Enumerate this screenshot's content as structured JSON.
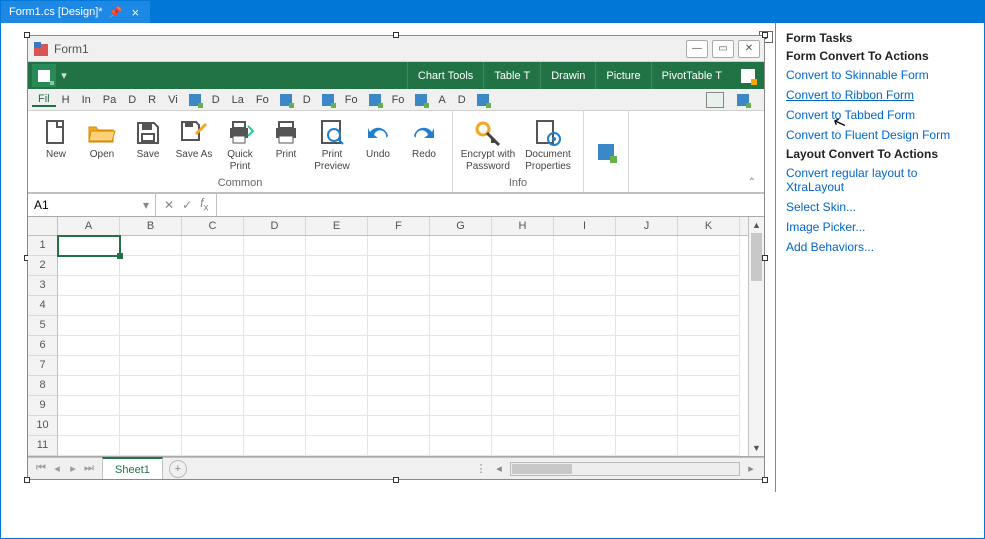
{
  "documentTab": {
    "title": "Form1.cs [Design]*"
  },
  "window": {
    "title": "Form1"
  },
  "contextTabs": [
    "Chart Tools",
    "Table T",
    "Drawin",
    "Picture",
    "PivotTable T"
  ],
  "tabs1": [
    "Fil",
    "H",
    "In",
    "Pa",
    "D",
    "R",
    "Vi"
  ],
  "tabs2": [
    "D",
    "La",
    "Fo"
  ],
  "tabs3": [
    "D"
  ],
  "tabs4": [
    "Fo"
  ],
  "tabs5": [
    "Fo"
  ],
  "tabs6": [
    "A",
    "D"
  ],
  "ribbon": {
    "common": {
      "name": "Common",
      "items": [
        "New",
        "Open",
        "Save",
        "Save As",
        "Quick Print",
        "Print",
        "Print Preview",
        "Undo",
        "Redo"
      ]
    },
    "info": {
      "name": "Info",
      "items": [
        "Encrypt with Password",
        "Document Properties"
      ]
    }
  },
  "formulaBar": {
    "cellRef": "A1"
  },
  "grid": {
    "cols": [
      "A",
      "B",
      "C",
      "D",
      "E",
      "F",
      "G",
      "H",
      "I",
      "J",
      "K"
    ],
    "rows": [
      1,
      2,
      3,
      4,
      5,
      6,
      7,
      8,
      9,
      10,
      11
    ]
  },
  "sheetTab": {
    "name": "Sheet1"
  },
  "taskPanel": {
    "h1": "Form Tasks",
    "h2": "Form Convert To Actions",
    "links1": [
      "Convert to Skinnable Form",
      "Convert to Ribbon Form",
      "Convert to Tabbed Form",
      "Convert to Fluent Design Form"
    ],
    "h3": "Layout Convert To Actions",
    "links2": [
      "Convert regular layout to XtraLayout"
    ],
    "links3": [
      "Select Skin...",
      "Image Picker...",
      "Add Behaviors..."
    ]
  }
}
